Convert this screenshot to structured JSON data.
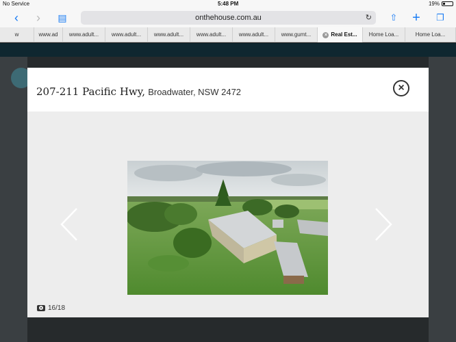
{
  "status": {
    "carrier": "No Service",
    "time": "5:48 PM",
    "battery": "19%"
  },
  "browser": {
    "url": "onthehouse.com.au",
    "tabs": [
      {
        "label": "w",
        "active": false
      },
      {
        "label": "www.ad",
        "active": false
      },
      {
        "label": "www.adult...",
        "active": false
      },
      {
        "label": "www.adult...",
        "active": false
      },
      {
        "label": "www.adult...",
        "active": false
      },
      {
        "label": "www.adult...",
        "active": false
      },
      {
        "label": "www.adult...",
        "active": false
      },
      {
        "label": "www.gumt...",
        "active": false
      },
      {
        "label": "Real Est...",
        "active": true
      },
      {
        "label": "Home Loa...",
        "active": false
      },
      {
        "label": "Home Loa...",
        "active": false
      }
    ]
  },
  "modal": {
    "street": "207-211 Pacific Hwy,",
    "locality": "Broadwater, NSW 2472",
    "counter": "16/18"
  },
  "colors": {
    "accent": "#1a7cf4",
    "overlay": "#262a2c",
    "site_header": "#0f2730"
  }
}
